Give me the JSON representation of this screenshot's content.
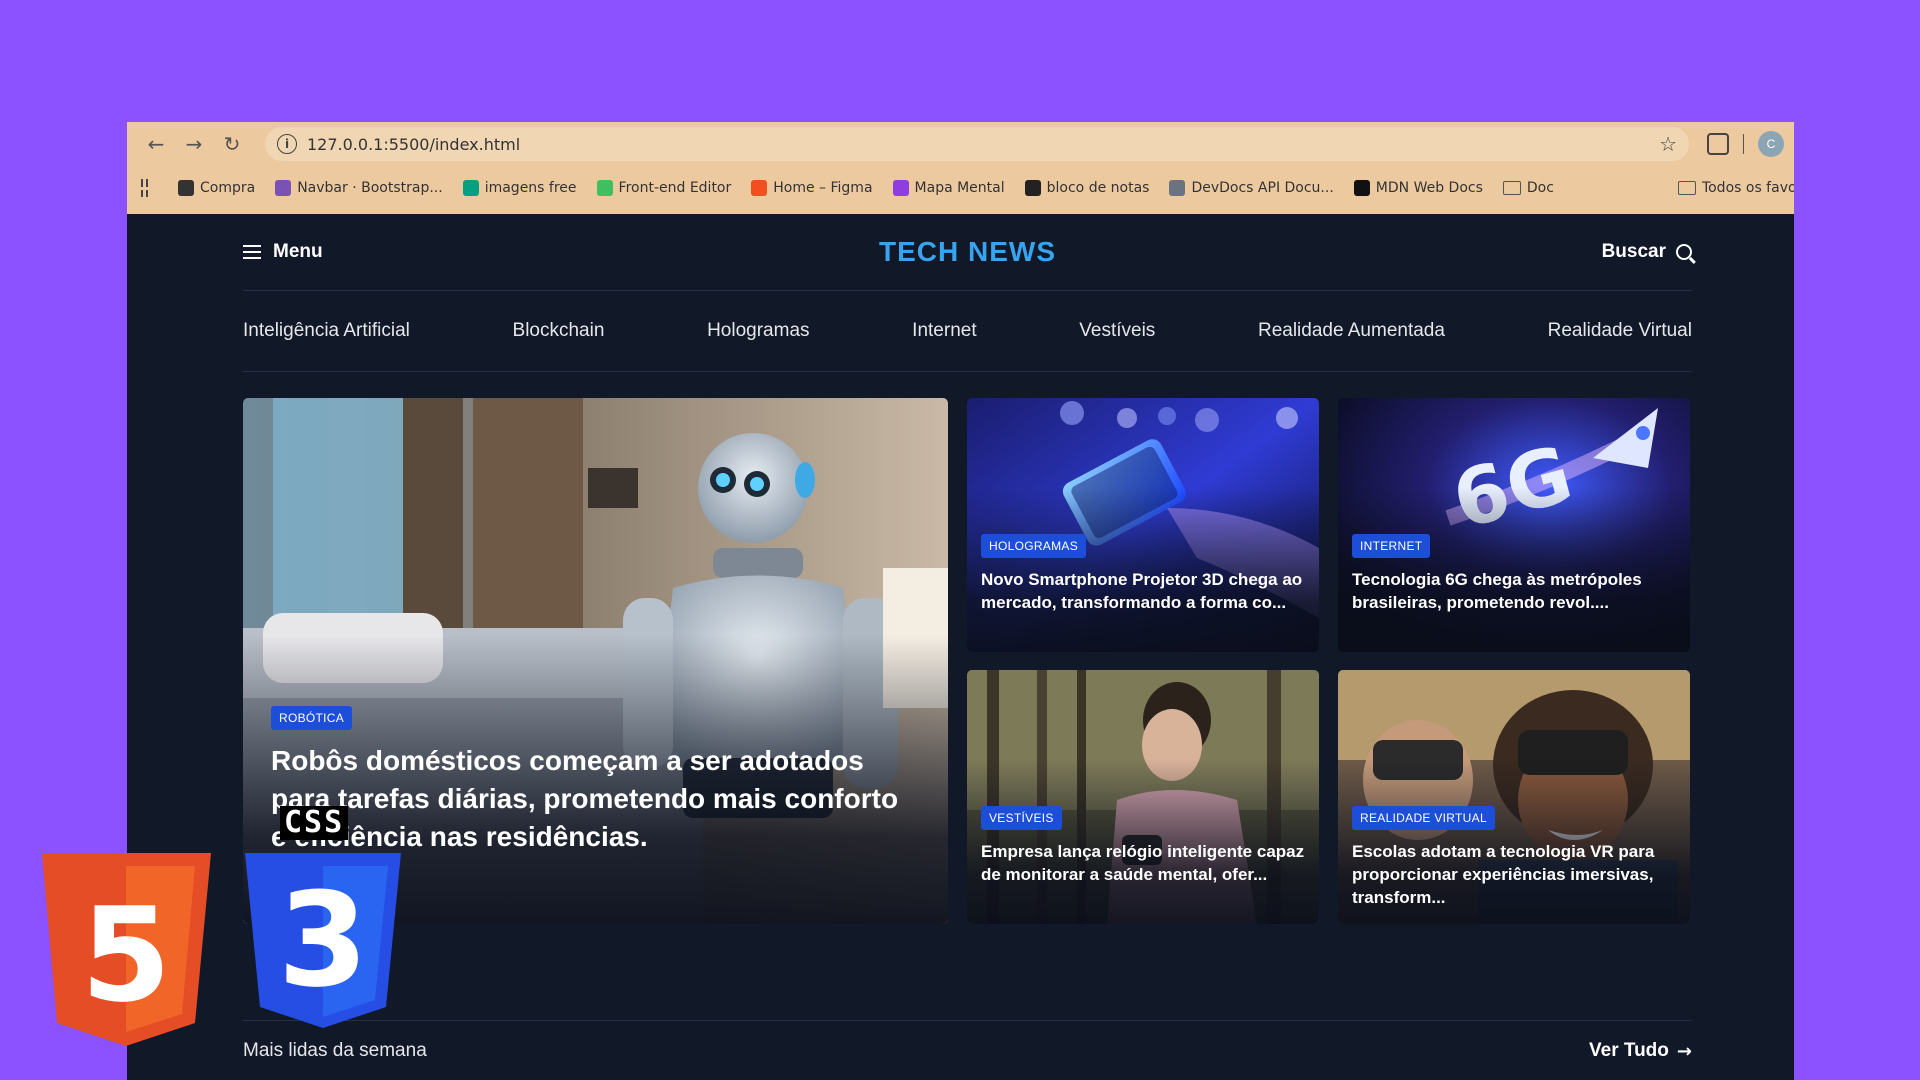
{
  "browser": {
    "url": "127.0.0.1:5500/index.html",
    "profile_initial": "C",
    "bookmarks": [
      {
        "label": "Compra",
        "icon": "compra-icon",
        "color": "#333333"
      },
      {
        "label": "Navbar · Bootstrap...",
        "icon": "bootstrap-icon",
        "color": "#7952b3"
      },
      {
        "label": "imagens free",
        "icon": "pexels-icon",
        "color": "#05a081"
      },
      {
        "label": "Front-end Editor",
        "icon": "frontend-editor-icon",
        "color": "#3fbf5f"
      },
      {
        "label": "Home – Figma",
        "icon": "figma-icon",
        "color": "#f24e1e"
      },
      {
        "label": "Mapa Mental",
        "icon": "mind-map-icon",
        "color": "#8e3ee0"
      },
      {
        "label": "bloco de notas",
        "icon": "notion-icon",
        "color": "#222222"
      },
      {
        "label": "DevDocs API Docu...",
        "icon": "devdocs-icon",
        "color": "#6b7280"
      },
      {
        "label": "MDN Web Docs",
        "icon": "mdn-icon",
        "color": "#111111"
      },
      {
        "label": "Doc",
        "icon": "folder-icon",
        "color": "#555555"
      }
    ],
    "other_bookmarks": "Todos os favor"
  },
  "site": {
    "menu_label": "Menu",
    "logo": "TECH NEWS",
    "search_label": "Buscar",
    "categories": [
      "Inteligência Artificial",
      "Blockchain",
      "Hologramas",
      "Internet",
      "Vestíveis",
      "Realidade Aumentada",
      "Realidade Virtual"
    ],
    "accent": "#38a3ef",
    "badge_color": "#1d4ed8",
    "featured": {
      "badge": "ROBÓTICA",
      "title": "Robôs domésticos começam a ser adotados para tarefas diárias, prometendo mais conforto e eficiência nas residências."
    },
    "articles": [
      {
        "badge": "HOLOGRAMAS",
        "title": "Novo Smartphone Projetor 3D chega ao mercado, transformando a forma co..."
      },
      {
        "badge": "INTERNET",
        "title": "Tecnologia 6G chega às metrópoles brasileiras, prometendo revol...."
      },
      {
        "badge": "VESTÍVEIS",
        "title": "Empresa lança relógio inteligente capaz de monitorar a saúde mental, ofer..."
      },
      {
        "badge": "REALIDADE VIRTUAL",
        "title": "Escolas adotam a tecnologia VR para proporcionar experiências imersivas, transform..."
      }
    ],
    "sixg_text": "6G",
    "most_read_label": "Mais lidas da semana",
    "see_all_label": "Ver Tudo"
  },
  "overlay": {
    "html5_numeral": "5",
    "css3_numeral": "3",
    "css_word": "CSS"
  }
}
